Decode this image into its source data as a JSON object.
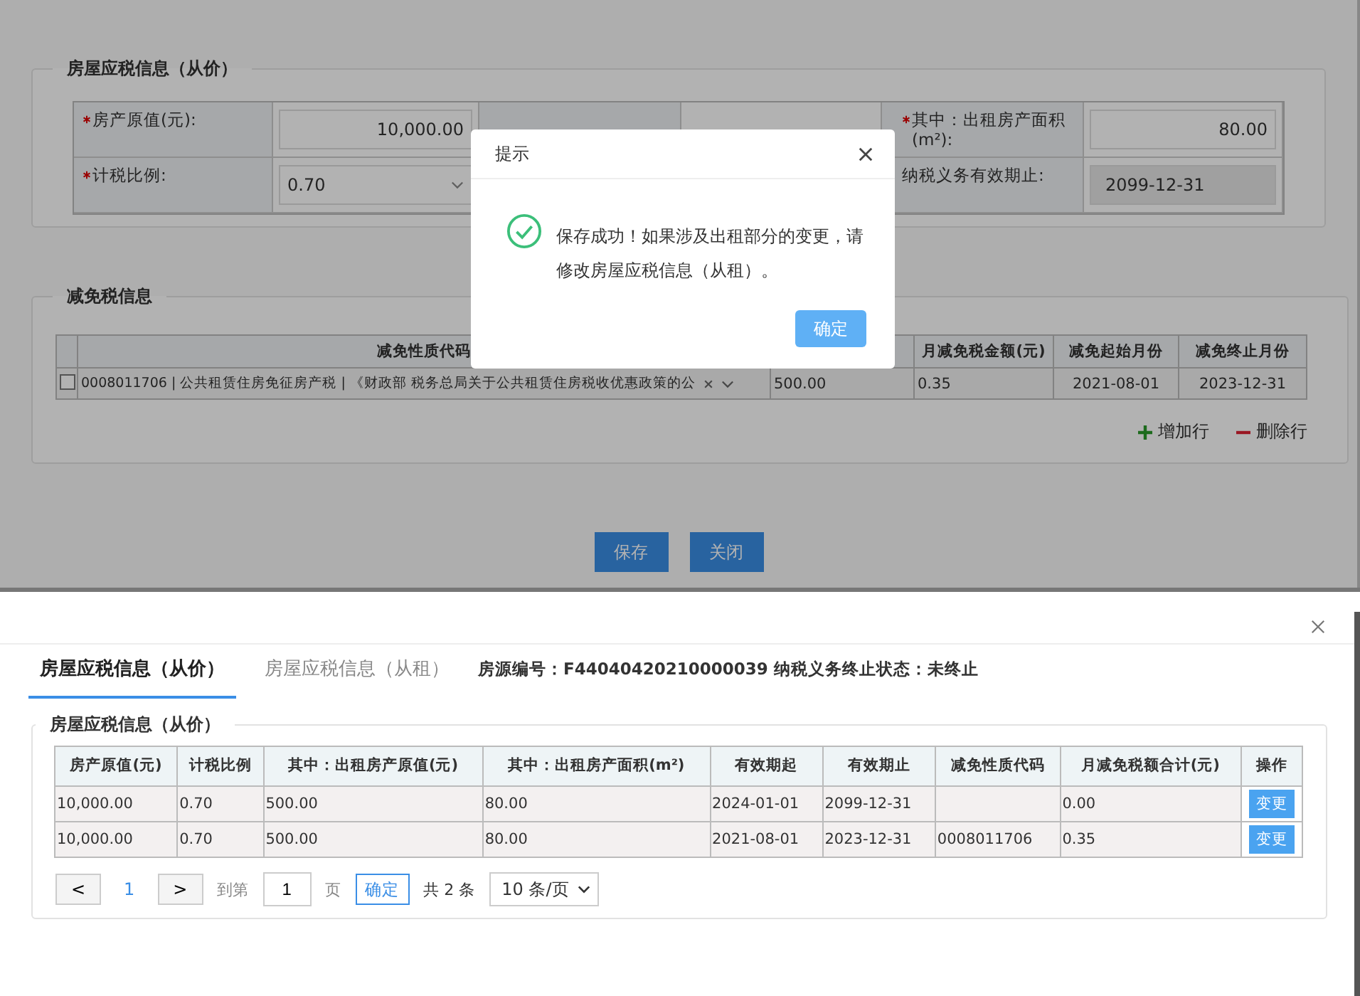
{
  "edit_page": {
    "price_section": {
      "title": "房屋应税信息（从价）",
      "fields": [
        {
          "label": "房产原值(元):",
          "value": "10,000.00",
          "kind": "input",
          "required": true
        },
        {
          "label": "其中：出租房产面积(m²):",
          "value": "80.00",
          "kind": "input",
          "required": true
        },
        {
          "label": "计税比例:",
          "value": "0.70",
          "kind": "select",
          "required": true
        },
        {
          "label": "纳税义务有效期止:",
          "value": "2099-12-31",
          "kind": "readonly",
          "required": false
        }
      ]
    },
    "exempt_section": {
      "title": "减免税信息",
      "columns": [
        "减免性质代码",
        "月减免税金额(元)",
        "减免起始月份",
        "减免终止月份"
      ],
      "rows": [
        {
          "checked": false,
          "code": "0008011706 | 公共租赁住房免征房产税 | 《财政部 税务总局关于公共租赁住房税收优惠政策的公",
          "column_3": "500.00",
          "amount": "0.35",
          "start": "2021-08-01",
          "end": "2023-12-31"
        }
      ],
      "add_label": "增加行",
      "delete_label": "删除行"
    },
    "buttons": [
      "保存",
      "关闭"
    ],
    "modal": {
      "title": "提示",
      "message": "保存成功！如果涉及出租部分的变更，请修改房屋应税信息（从租）。",
      "ok": "确定"
    }
  },
  "detail_dialog": {
    "tabs": [
      {
        "label": "房屋应税信息（从价）",
        "selected": true
      },
      {
        "label": "房屋应税信息（从租）",
        "selected": false
      }
    ],
    "info": "房源编号：F44040420210000039 纳税义务终止状态：未终止",
    "section_title": "房屋应税信息（从价）",
    "table": {
      "columns": [
        "房产原值(元)",
        "计税比例",
        "其中：出租房产原值(元)",
        "其中：出租房产面积(m²)",
        "有效期起",
        "有效期止",
        "减免性质代码",
        "月减免税额合计(元)",
        "操作"
      ],
      "rows": [
        {
          "cells": [
            "10,000.00",
            "0.70",
            "500.00",
            "80.00",
            "2024-01-01",
            "2099-12-31",
            "",
            "0.00"
          ],
          "action": "变更"
        },
        {
          "cells": [
            "10,000.00",
            "0.70",
            "500.00",
            "80.00",
            "2021-08-01",
            "2023-12-31",
            "0008011706",
            "0.35"
          ],
          "action": "变更"
        }
      ]
    },
    "pager": {
      "prev": "<",
      "page": "1",
      "next": ">",
      "goto_label": "到第",
      "goto_value": "1",
      "page_unit": "页",
      "confirm": "确定",
      "total": "共 2 条",
      "page_size": "10 条/页"
    }
  }
}
